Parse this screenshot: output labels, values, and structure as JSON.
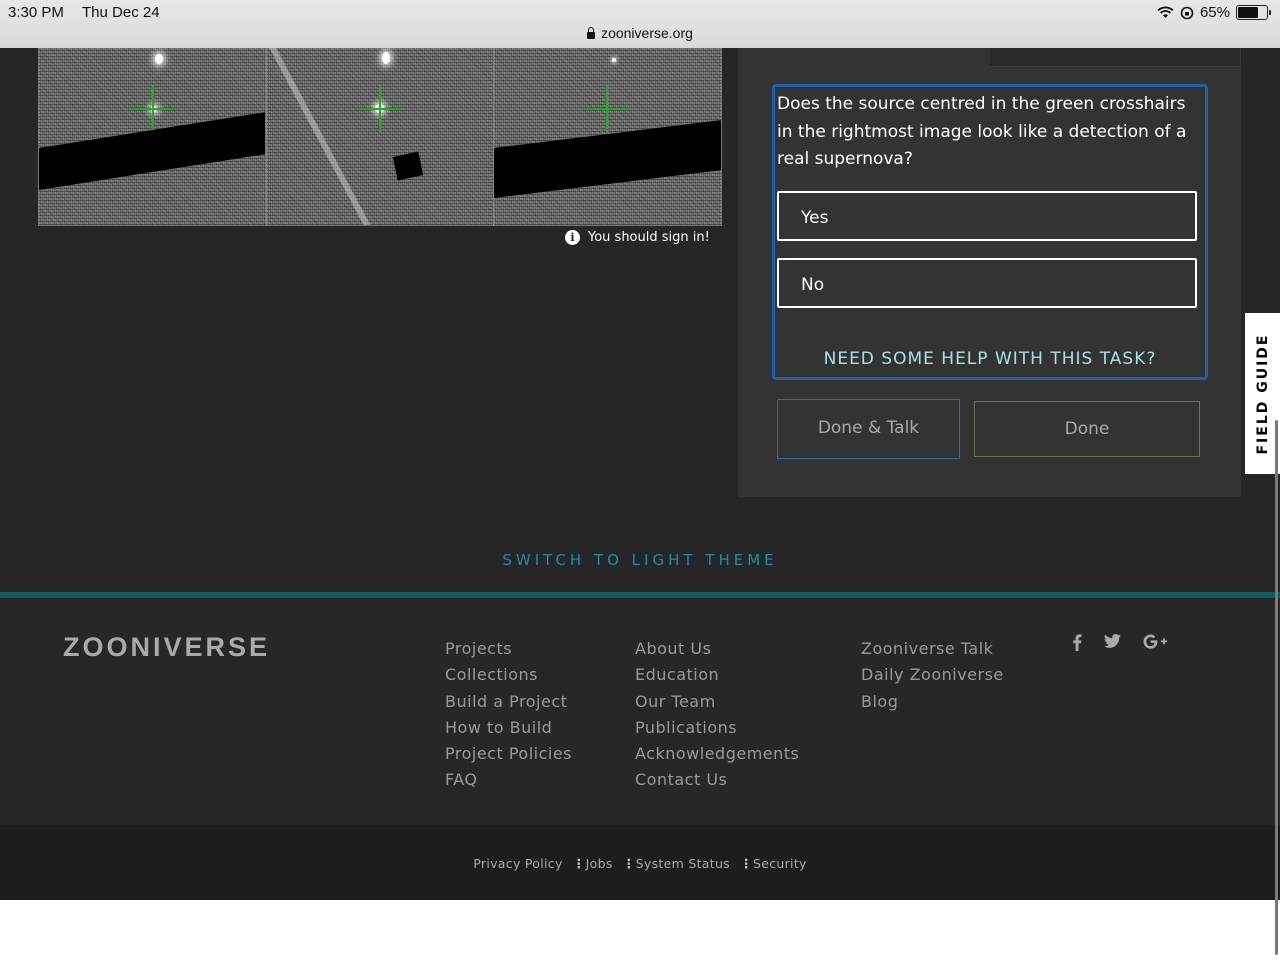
{
  "status_bar": {
    "time": "3:30 PM",
    "date": "Thu Dec 24",
    "battery": "65%",
    "url": "zooniverse.org"
  },
  "subject": {
    "sign_in_note": "You should sign in!"
  },
  "task": {
    "question": "Does the source centred in the green crosshairs in the rightmost image look like a detection of a real supernova?",
    "answers": [
      "Yes",
      "No"
    ],
    "help_link": "NEED SOME HELP WITH THIS TASK?",
    "done_talk_label": "Done & Talk",
    "done_label": "Done"
  },
  "field_guide_label": "FIELD GUIDE",
  "theme_toggle": "SWITCH TO LIGHT THEME",
  "footer": {
    "logo": "ZOONIVERSE",
    "col1": [
      "Projects",
      "Collections",
      "Build a Project",
      "How to Build",
      "Project Policies",
      "FAQ"
    ],
    "col2": [
      "About Us",
      "Education",
      "Our Team",
      "Publications",
      "Acknowledgements",
      "Contact Us"
    ],
    "col3": [
      "Zooniverse Talk",
      "Daily Zooniverse",
      "Blog"
    ],
    "social_icons": [
      "facebook-icon",
      "twitter-icon",
      "google-plus-icon"
    ]
  },
  "legal": [
    "Privacy Policy",
    "Jobs",
    "System Status",
    "Security"
  ],
  "colors": {
    "background": "#262626",
    "task_border": "#1f5fa8",
    "accent_teal": "#1c8e9e",
    "help_text": "#a9e2e2",
    "crosshair": "#1fae1f"
  }
}
